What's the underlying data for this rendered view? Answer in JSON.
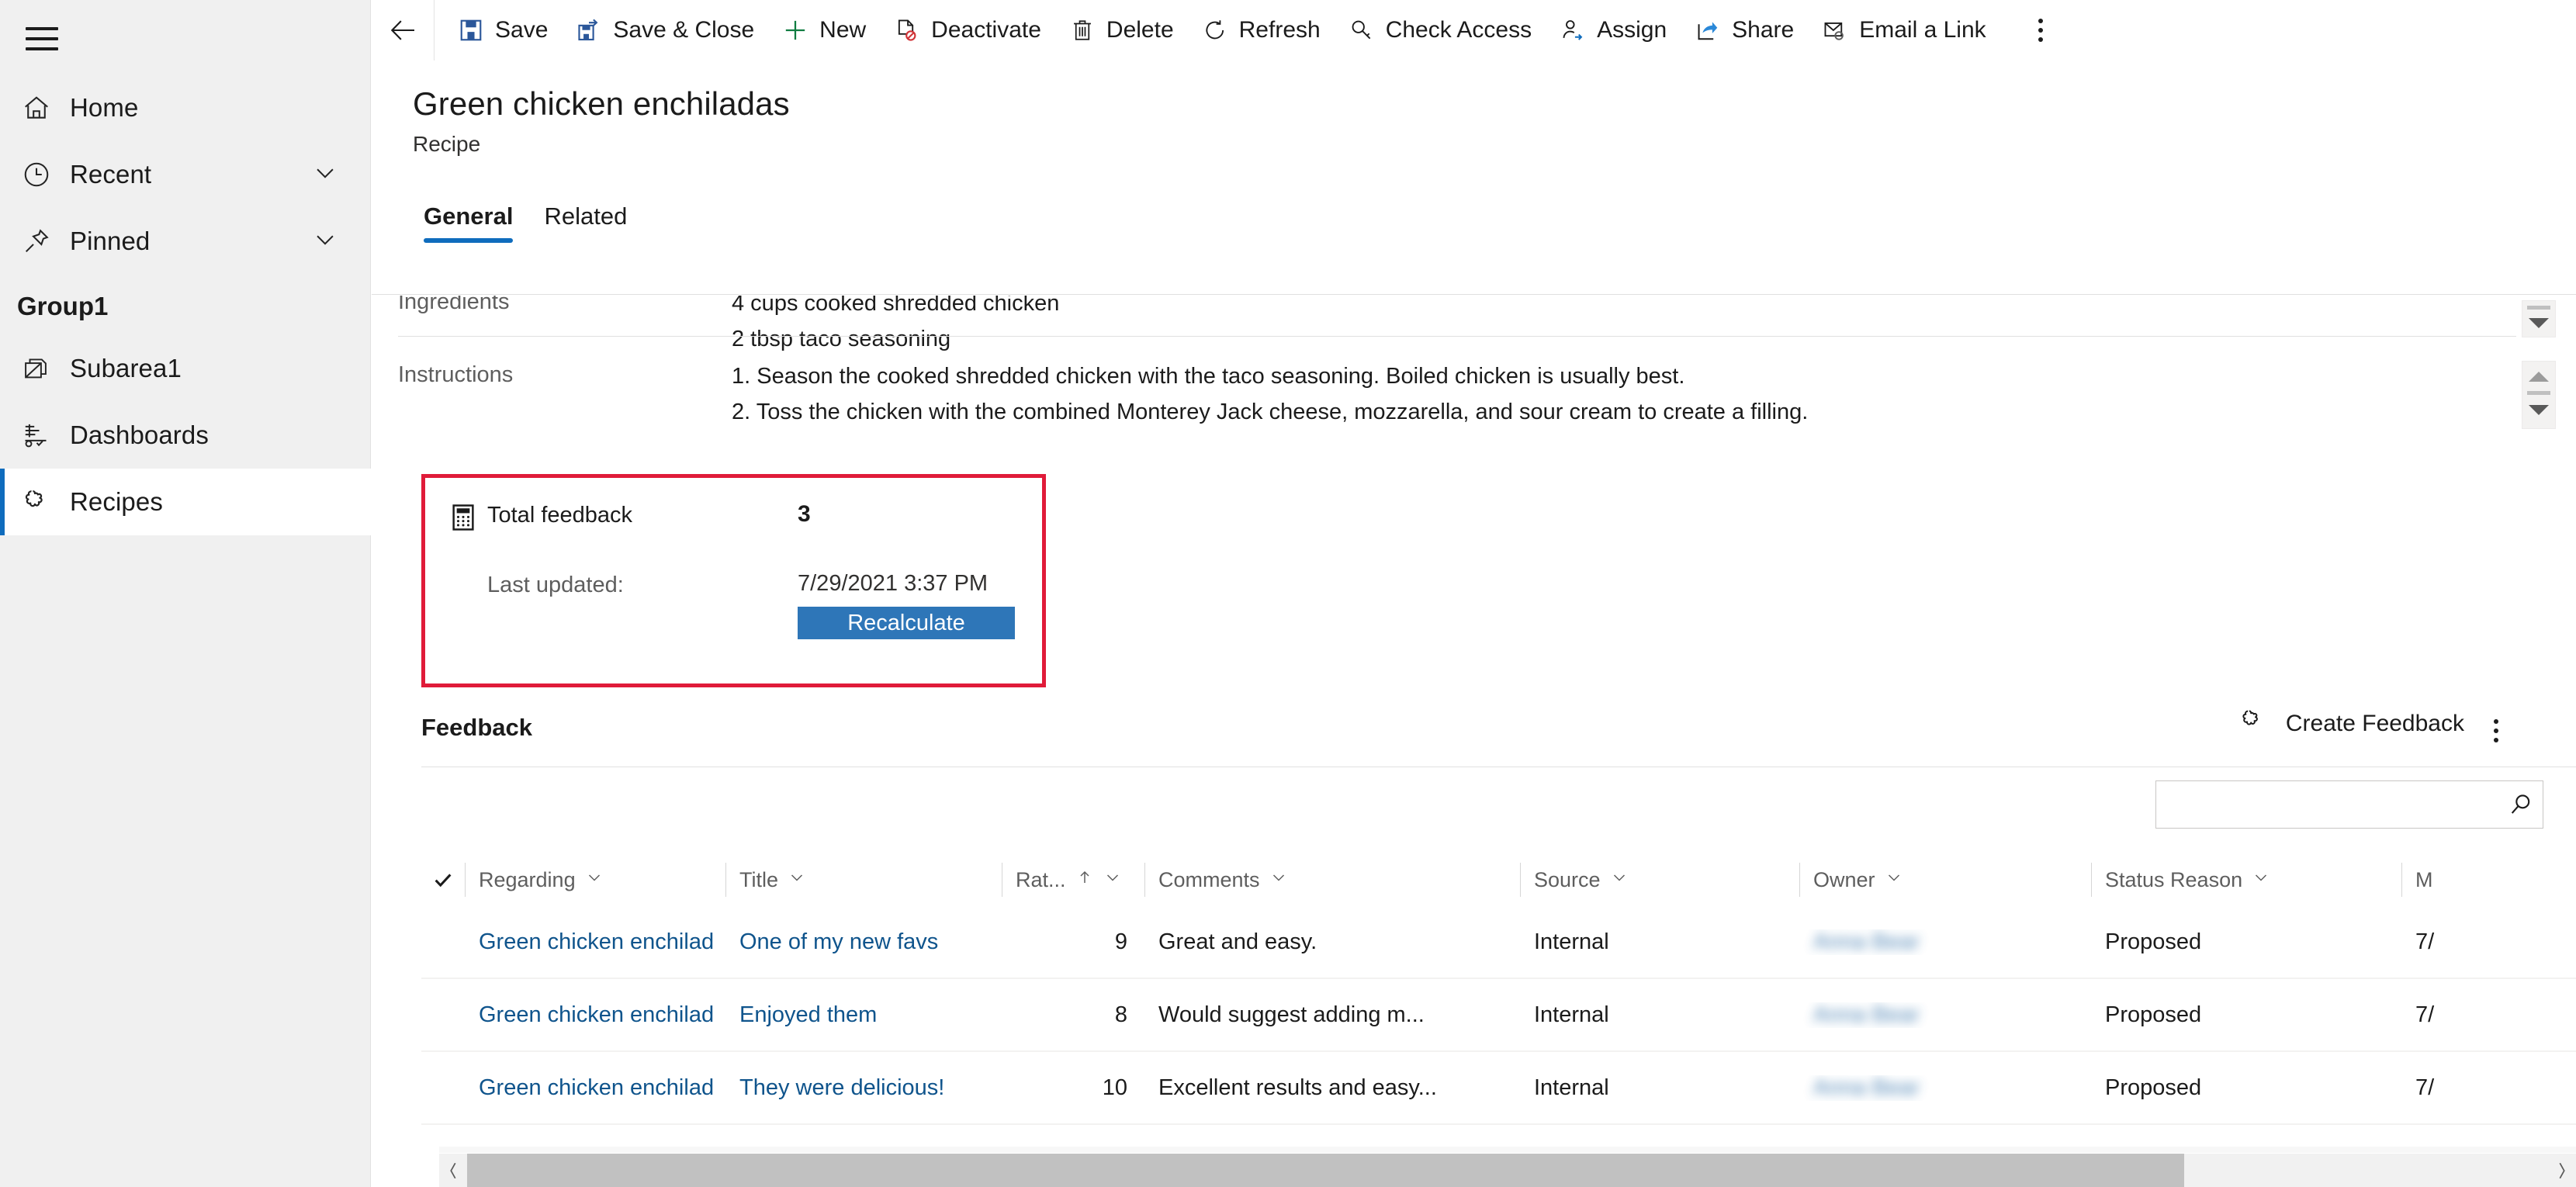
{
  "sidebar": {
    "menu_icon": "hamburger-icon",
    "items": [
      {
        "label": "Home",
        "icon": "home-icon",
        "chevron": false,
        "selected": false
      },
      {
        "label": "Recent",
        "icon": "clock-icon",
        "chevron": true,
        "selected": false
      },
      {
        "label": "Pinned",
        "icon": "pin-icon",
        "chevron": true,
        "selected": false
      }
    ],
    "group_label": "Group1",
    "group_items": [
      {
        "label": "Subarea1",
        "icon": "entity-icon",
        "selected": false
      },
      {
        "label": "Dashboards",
        "icon": "dashboard-icon",
        "selected": false
      },
      {
        "label": "Recipes",
        "icon": "recipe-icon",
        "selected": true
      }
    ]
  },
  "commandbar": {
    "back_icon": "back-arrow-icon",
    "commands": [
      {
        "label": "Save",
        "icon": "save-icon"
      },
      {
        "label": "Save & Close",
        "icon": "save-and-close-icon"
      },
      {
        "label": "New",
        "icon": "plus-icon"
      },
      {
        "label": "Deactivate",
        "icon": "deactivate-icon"
      },
      {
        "label": "Delete",
        "icon": "trash-icon"
      },
      {
        "label": "Refresh",
        "icon": "refresh-icon"
      },
      {
        "label": "Check Access",
        "icon": "key-icon"
      },
      {
        "label": "Assign",
        "icon": "assign-user-icon"
      },
      {
        "label": "Share",
        "icon": "share-icon"
      },
      {
        "label": "Email a Link",
        "icon": "email-link-icon"
      }
    ],
    "overflow_icon": "more-vertical-icon"
  },
  "header": {
    "title": "Green chicken enchiladas",
    "subtitle": "Recipe",
    "tabs": [
      {
        "label": "General",
        "active": true
      },
      {
        "label": "Related",
        "active": false
      }
    ]
  },
  "form": {
    "fields": [
      {
        "label": "Ingredients",
        "lines": [
          "4 cups cooked shredded chicken",
          "2 tbsp taco seasoning"
        ]
      },
      {
        "label": "Instructions",
        "lines": [
          "1. Season the cooked shredded chicken with the taco seasoning. Boiled chicken is usually best.",
          "2. Toss the chicken with the combined Monterey Jack cheese, mozzarella, and sour cream to create a filling."
        ]
      }
    ]
  },
  "total_feedback_card": {
    "icon": "calculator-icon",
    "label": "Total feedback",
    "value": "3",
    "last_updated_label": "Last updated:",
    "last_updated_value": "7/29/2021 3:37 PM",
    "button_label": "Recalculate",
    "highlight_color": "#e01b39",
    "button_color": "#2e76b8"
  },
  "feedback_grid": {
    "title": "Feedback",
    "create_label": "Create Feedback",
    "create_icon": "recipe-icon",
    "overflow_icon": "more-vertical-icon",
    "search": {
      "value": "",
      "placeholder": "",
      "icon": "search-icon"
    },
    "columns": [
      {
        "key": "check",
        "label": "",
        "icon": "checkmark-icon",
        "sorted": false
      },
      {
        "key": "regarding",
        "label": "Regarding",
        "icon": "chevron-down-icon",
        "sorted": false
      },
      {
        "key": "title",
        "label": "Title",
        "icon": "chevron-down-icon",
        "sorted": false
      },
      {
        "key": "rating",
        "label": "Rat...",
        "icon": "chevron-down-icon",
        "sorted": true,
        "sort_dir": "asc"
      },
      {
        "key": "comments",
        "label": "Comments",
        "icon": "chevron-down-icon",
        "sorted": false
      },
      {
        "key": "source",
        "label": "Source",
        "icon": "chevron-down-icon",
        "sorted": false
      },
      {
        "key": "owner",
        "label": "Owner",
        "icon": "chevron-down-icon",
        "sorted": false
      },
      {
        "key": "status",
        "label": "Status Reason",
        "icon": "chevron-down-icon",
        "sorted": false
      },
      {
        "key": "modified",
        "label": "M",
        "icon": "",
        "sorted": false
      }
    ],
    "rows": [
      {
        "regarding": "Green chicken enchilad",
        "title": "One of my new favs",
        "rating": "9",
        "comments": "Great and easy.",
        "source": "Internal",
        "owner": "",
        "status": "Proposed",
        "modified": "7/"
      },
      {
        "regarding": "Green chicken enchilad",
        "title": "Enjoyed them",
        "rating": "8",
        "comments": "Would suggest adding m...",
        "source": "Internal",
        "owner": "",
        "status": "Proposed",
        "modified": "7/"
      },
      {
        "regarding": "Green chicken enchilad",
        "title": "They were delicious!",
        "rating": "10",
        "comments": "Excellent results and easy...",
        "source": "Internal",
        "owner": "",
        "status": "Proposed",
        "modified": "7/"
      }
    ]
  },
  "scrollbars": {
    "horizontal": {
      "left_arrow_icon": "chevron-left-icon",
      "right_arrow_icon": "chevron-right-icon"
    },
    "textarea_ingredients": {
      "down_icon": "triangle-down-icon"
    },
    "textarea_instructions": {
      "up_icon": "triangle-up-icon",
      "down_icon": "triangle-down-icon"
    }
  }
}
